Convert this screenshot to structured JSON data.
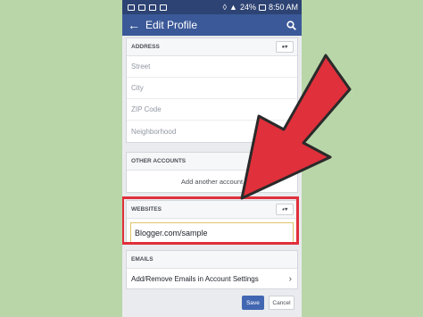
{
  "status_bar": {
    "battery": "24%",
    "time": "8:50 AM"
  },
  "app_bar": {
    "title": "Edit Profile",
    "back_icon": "back-arrow-icon",
    "search_icon": "search-icon"
  },
  "address": {
    "header": "ADDRESS",
    "fields": [
      "Street",
      "City",
      "ZIP Code",
      "Neighborhood"
    ]
  },
  "other_accounts": {
    "header": "OTHER ACCOUNTS",
    "add_label": "Add another account"
  },
  "websites": {
    "header": "WEBSITES",
    "value": "Blogger.com/sample"
  },
  "emails": {
    "header": "EMAILS",
    "link": "Add/Remove Emails in Account Settings"
  },
  "actions": {
    "save": "Save",
    "cancel": "Cancel"
  },
  "colors": {
    "brand": "#3b5998",
    "highlight": "#e0303b",
    "background": "#b9d6a8"
  }
}
